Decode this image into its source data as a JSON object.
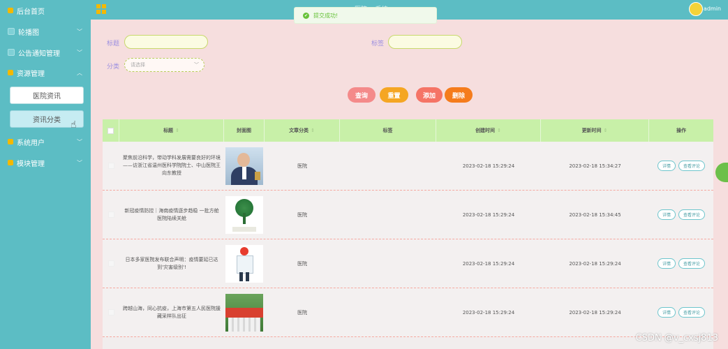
{
  "sidebar": {
    "items": [
      {
        "label": "后台首页",
        "icon": "home-icon",
        "color": "#f4b800"
      },
      {
        "label": "轮播图",
        "icon": "image-icon",
        "color": "#7fd0d6"
      },
      {
        "label": "公告通知管理",
        "icon": "notice-icon",
        "color": "#7fd0d6"
      },
      {
        "label": "资源管理",
        "icon": "resource-icon",
        "color": "#f4b800"
      },
      {
        "label": "系统用户",
        "icon": "user-icon",
        "color": "#f4b800"
      },
      {
        "label": "模块管理",
        "icon": "module-icon",
        "color": "#f4b800"
      }
    ],
    "sub_items": [
      {
        "label": "医院资讯"
      },
      {
        "label": "资讯分类"
      }
    ]
  },
  "topbar": {
    "title": "医院... 系统",
    "user": "admin"
  },
  "toast": {
    "message": "提交成功!"
  },
  "search": {
    "title_label": "标题",
    "tag_label": "标签",
    "category_label": "分类",
    "category_placeholder": "请选择"
  },
  "actions": {
    "query": "查询",
    "reset": "重置",
    "add": "添加",
    "delete": "删除"
  },
  "table": {
    "headers": [
      "标题",
      "封面图",
      "文章分类",
      "标签",
      "创建时间",
      "更新时间",
      "操作"
    ],
    "detail_label": "详情",
    "comment_label": "查看评论",
    "rows": [
      {
        "title": "聚焦前沿科学，带动学科发展需要良好的环境——访浙江省温州医科学院院士、中山医院王向东教授",
        "category": "医院",
        "tag": "",
        "created": "2023-02-18 15:29:24",
        "updated": "2023-02-18 15:34:27"
      },
      {
        "title": "新冠疫情防控｜海南疫情逐步趋稳 一批方舱医院陆续关舱",
        "category": "医院",
        "tag": "",
        "created": "2023-02-18 15:29:24",
        "updated": "2023-02-18 15:34:45"
      },
      {
        "title": "日本多家医院发布联合声明：疫情要延已达到'灾害级别'!",
        "category": "医院",
        "tag": "",
        "created": "2023-02-18 15:29:24",
        "updated": "2023-02-18 15:29:24"
      },
      {
        "title": "跨越山海，同心抗疫，上海市第五人民医院援藏采样队出征",
        "category": "医院",
        "tag": "",
        "created": "2023-02-18 15:29:24",
        "updated": "2023-02-18 15:29:24"
      }
    ]
  },
  "watermark": "CSDN @v_cxsj813",
  "colors": {
    "sidebar": "#5cbdc4",
    "page_bg": "#f6dede",
    "table_header": "#c8f0a8",
    "query_btn": "#f48a8a",
    "reset_btn": "#f5a623",
    "add_btn": "#f57466",
    "delete_btn": "#f57c1c"
  }
}
